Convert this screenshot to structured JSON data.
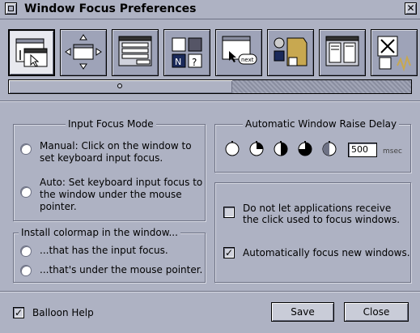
{
  "window": {
    "title": "Window Focus Preferences"
  },
  "icons": [
    {
      "name": "focus-prefs-icon",
      "selected": true
    },
    {
      "name": "window-move-icon",
      "selected": false
    },
    {
      "name": "window-list-icon",
      "selected": false
    },
    {
      "name": "app-grid-icon",
      "selected": false
    },
    {
      "name": "window-pointer-icon",
      "selected": false
    },
    {
      "name": "apps-folder-icon",
      "selected": false
    },
    {
      "name": "window-layout-icon",
      "selected": false
    },
    {
      "name": "window-close-icon",
      "selected": false
    }
  ],
  "input_focus": {
    "title": "Input Focus Mode",
    "manual_line1": "Manual:  Click on the window to",
    "manual_line2": "set keyboard input focus.",
    "auto_line1": "Auto:  Set keyboard input focus to",
    "auto_line2": "the window under the mouse",
    "auto_line3": "pointer."
  },
  "colormap": {
    "title": "Install colormap in the window...",
    "option1": "...that has the input focus.",
    "option2": "...that's under the mouse pointer."
  },
  "raise_delay": {
    "title": "Automatic Window Raise Delay",
    "value": "500",
    "unit": "msec"
  },
  "options": {
    "click_through": "Do not let applications receive",
    "click_through_2": "the click used to focus windows.",
    "click_through_checked": false,
    "auto_focus": "Automatically focus new windows.",
    "auto_focus_checked": true
  },
  "footer": {
    "balloon_help": "Balloon Help",
    "balloon_help_checked": true,
    "save": "Save",
    "close": "Close"
  }
}
